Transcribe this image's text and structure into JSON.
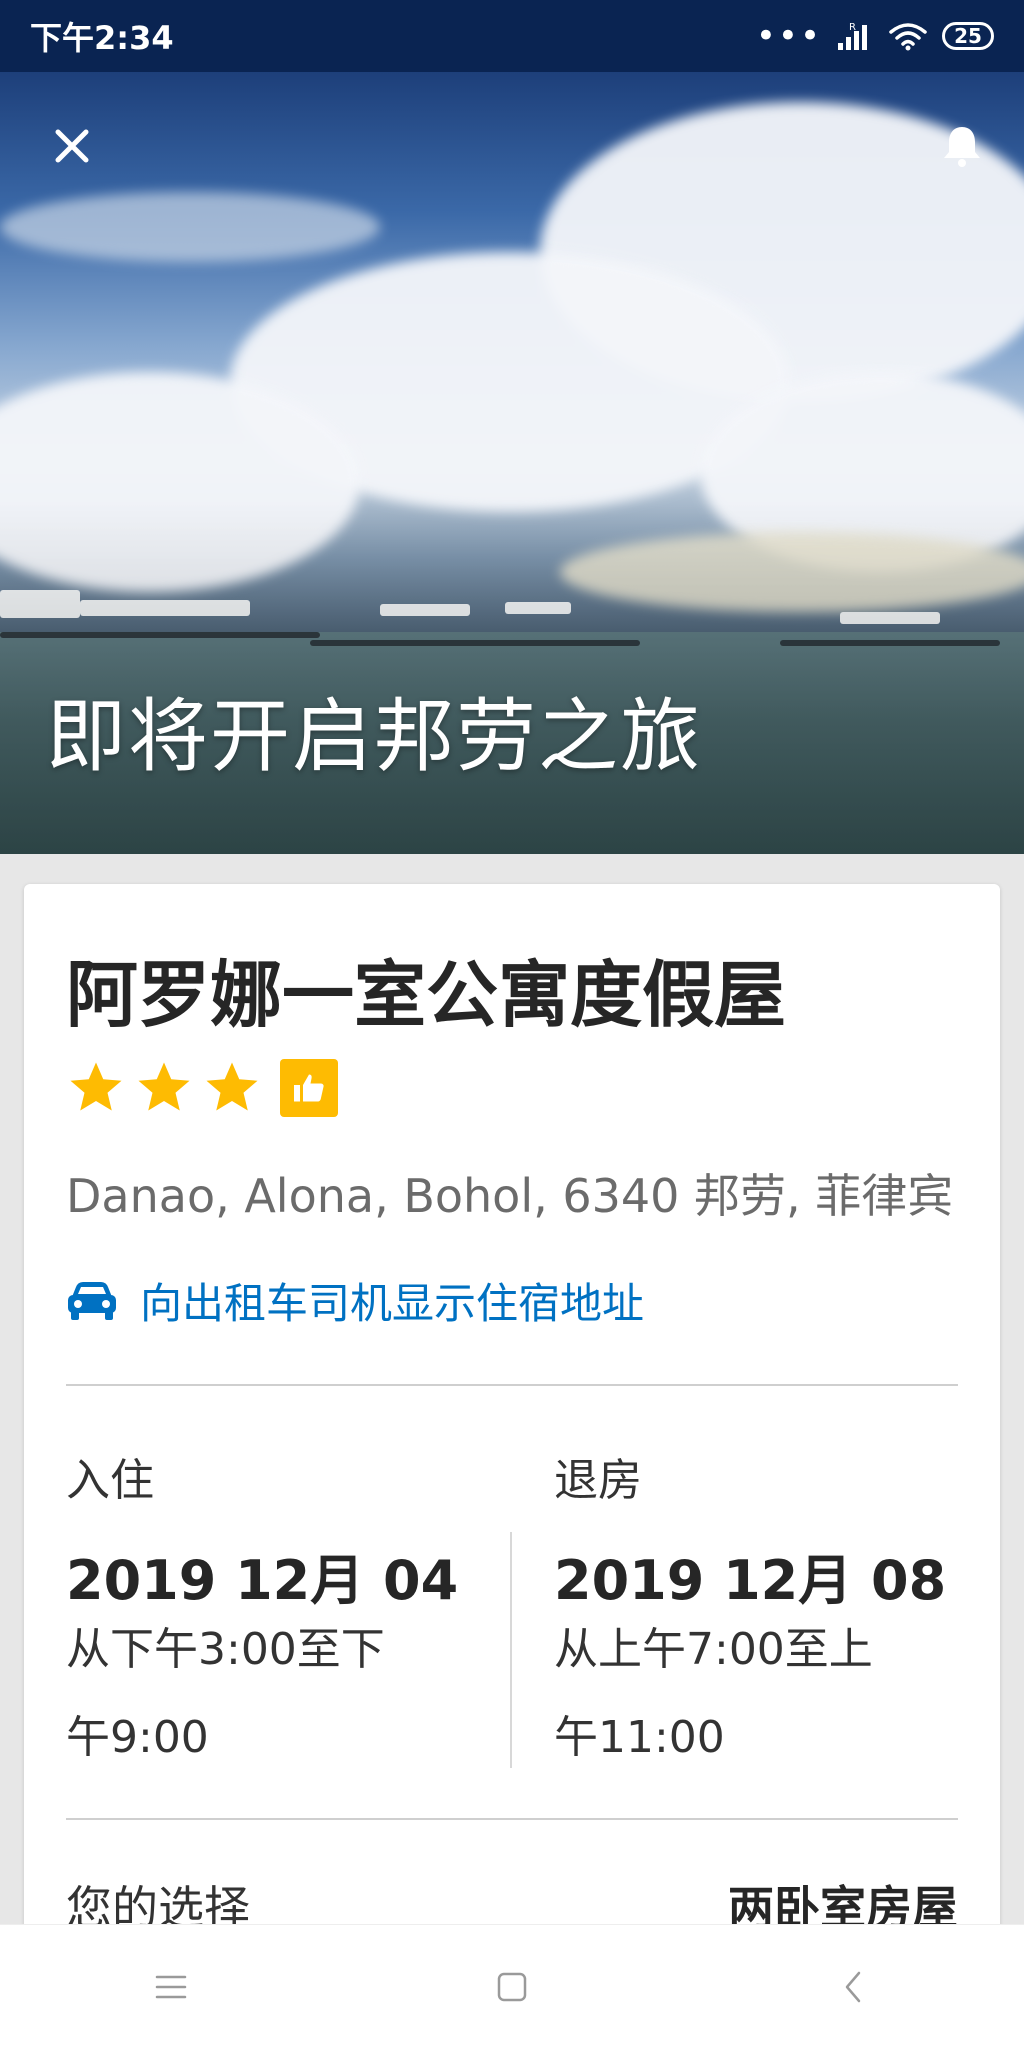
{
  "status_bar": {
    "time": "下午2:34",
    "signal_label": "R",
    "battery": "25"
  },
  "hero": {
    "title": "即将开启邦劳之旅",
    "close_icon": "close-icon",
    "bell_icon": "bell-icon"
  },
  "property": {
    "name": "阿罗娜一室公寓度假屋",
    "stars": 3,
    "address": "Danao, Alona, Bohol, 6340 邦劳, 菲律宾",
    "taxi_link": "向出租车司机显示住宿地址",
    "colors": {
      "star": "#febb02",
      "link": "#0071c2"
    }
  },
  "checkin": {
    "label": "入住",
    "date": "2019 12月 04",
    "time": "从下午3:00至下午9:00"
  },
  "checkout": {
    "label": "退房",
    "date": "2019 12月 08",
    "time": "从上午7:00至上午11:00"
  },
  "choice": {
    "label": "您的选择",
    "value": "两卧室房屋"
  },
  "nav": {
    "menu_icon": "menu-icon",
    "home_icon": "home-icon",
    "back_icon": "back-icon"
  }
}
